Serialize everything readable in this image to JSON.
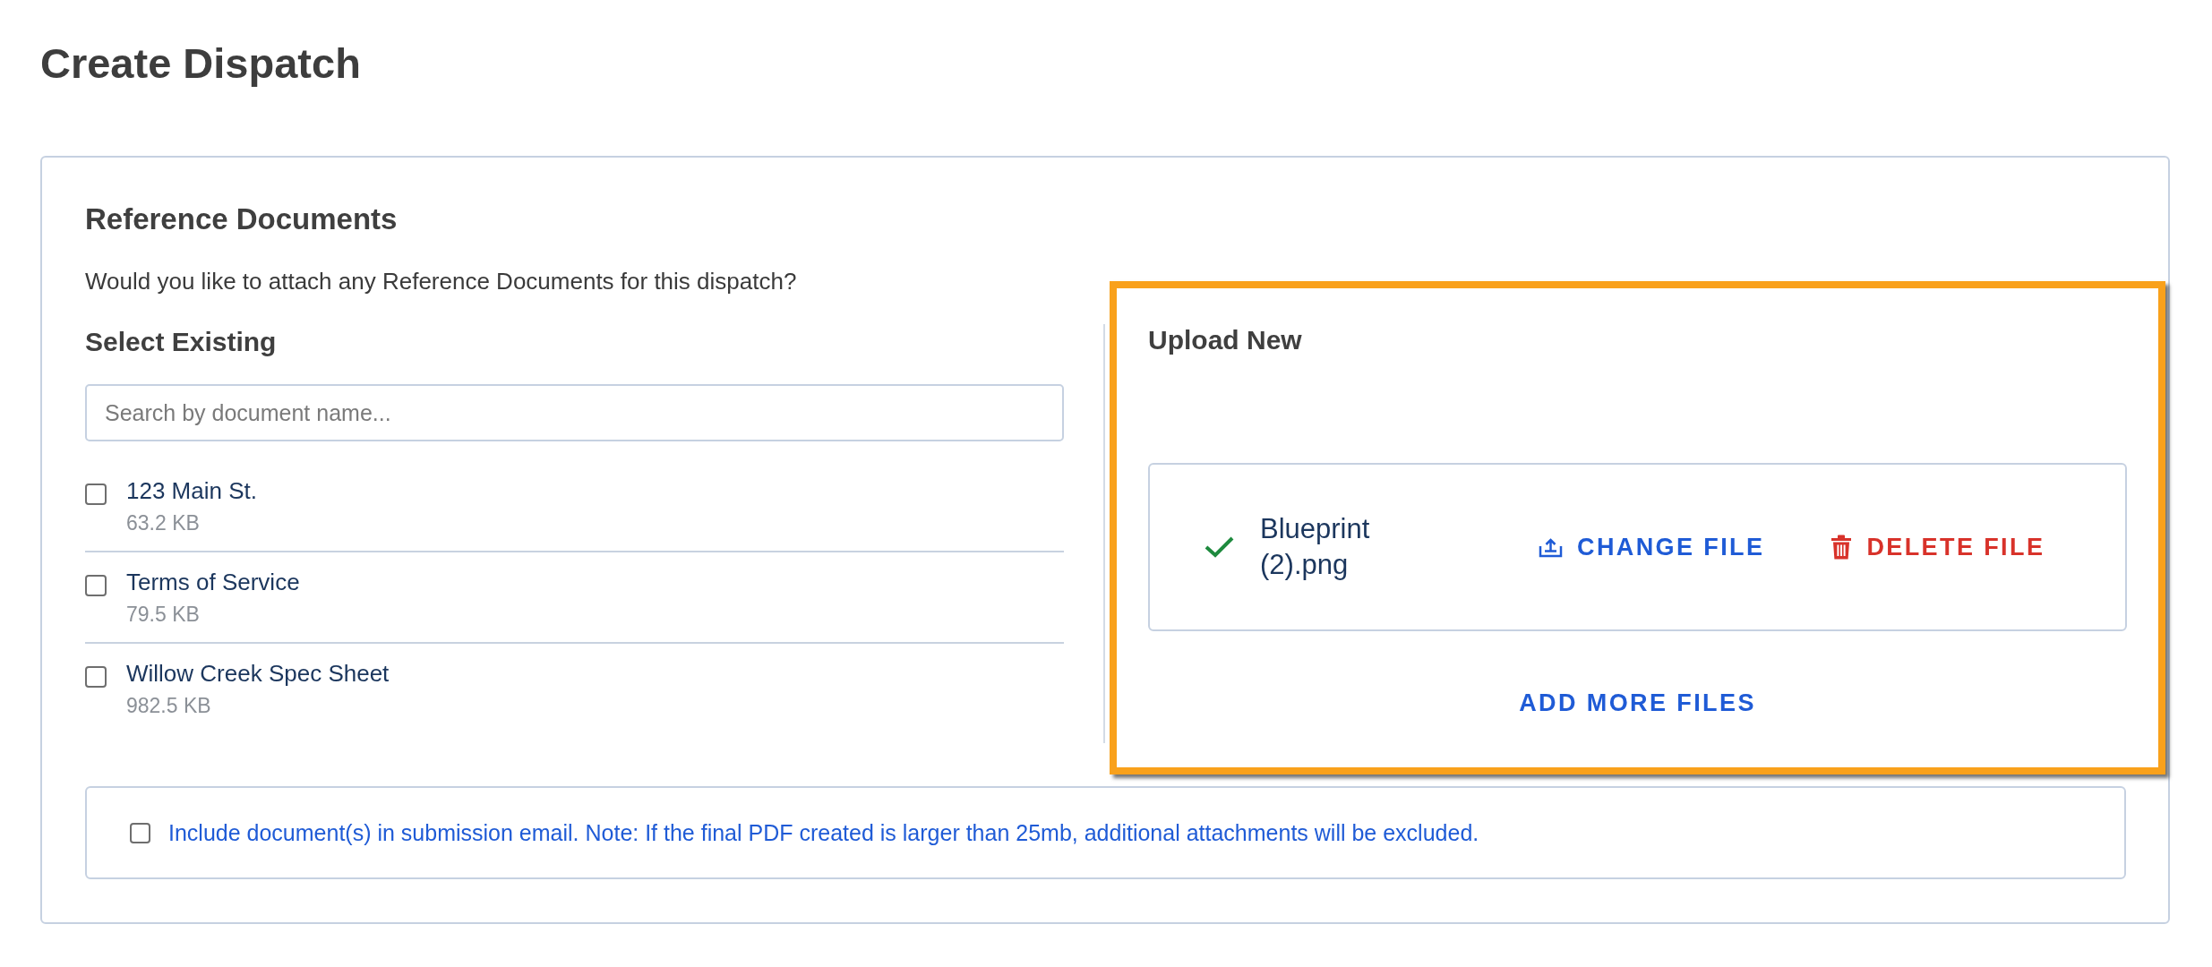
{
  "page": {
    "title": "Create Dispatch"
  },
  "reference_documents": {
    "title": "Reference Documents",
    "question": "Would you like to attach any Reference Documents for this dispatch?",
    "select_existing": {
      "title": "Select Existing",
      "search": {
        "placeholder": "Search by document name..."
      },
      "documents": [
        {
          "name": "123 Main St.",
          "size": "63.2 KB",
          "checked": false
        },
        {
          "name": "Terms of Service",
          "size": "79.5 KB",
          "checked": false
        },
        {
          "name": "Willow Creek Spec Sheet",
          "size": "982.5 KB",
          "checked": false
        }
      ]
    },
    "upload_new": {
      "title": "Upload New",
      "highlighted": true,
      "files": [
        {
          "name": "Blueprint (2).png",
          "uploaded": true,
          "actions": [
            {
              "kind": "change",
              "label": "CHANGE FILE"
            },
            {
              "kind": "delete",
              "label": "DELETE FILE"
            }
          ]
        }
      ],
      "add_more": "ADD MORE FILES"
    },
    "include_in_email": {
      "label": "Include document(s) in submission email. Note: If the final PDF created is larger than 25mb, additional attachments will be excluded.",
      "checked": false
    }
  }
}
